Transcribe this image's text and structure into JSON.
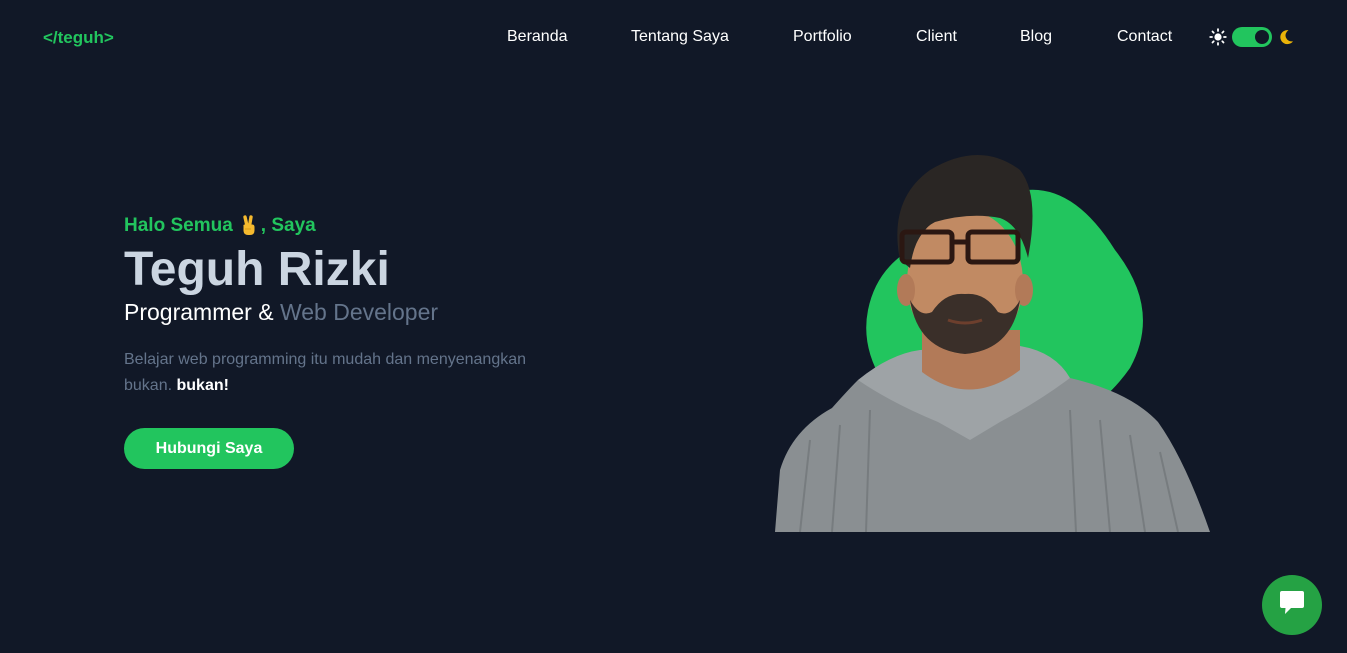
{
  "brand": {
    "logo": "</teguh>"
  },
  "nav": {
    "items": [
      {
        "label": "Beranda"
      },
      {
        "label": "Tentang Saya"
      },
      {
        "label": "Portfolio"
      },
      {
        "label": "Client"
      },
      {
        "label": "Blog"
      },
      {
        "label": "Contact"
      }
    ]
  },
  "theme": {
    "sun_icon": "sun-icon",
    "moon_icon": "moon-icon",
    "dark_mode": true
  },
  "hero": {
    "greeting_before": "Halo Semua",
    "greeting_emoji": "victory-hand-icon",
    "greeting_after": ", Saya",
    "name": "Teguh Rizki",
    "role_main": "Programmer & ",
    "role_accent": "Web Developer",
    "tagline": "Belajar web programming itu mudah dan menyenangkan bukan.",
    "tagline_bold": "bukan!",
    "cta_label": "Hubungi Saya"
  },
  "chat": {
    "icon": "chat-bubble-icon"
  },
  "colors": {
    "background": "#111827",
    "accent": "#22c55e",
    "muted": "#64748b",
    "heading": "#cbd5e1",
    "moon": "#eab308"
  }
}
